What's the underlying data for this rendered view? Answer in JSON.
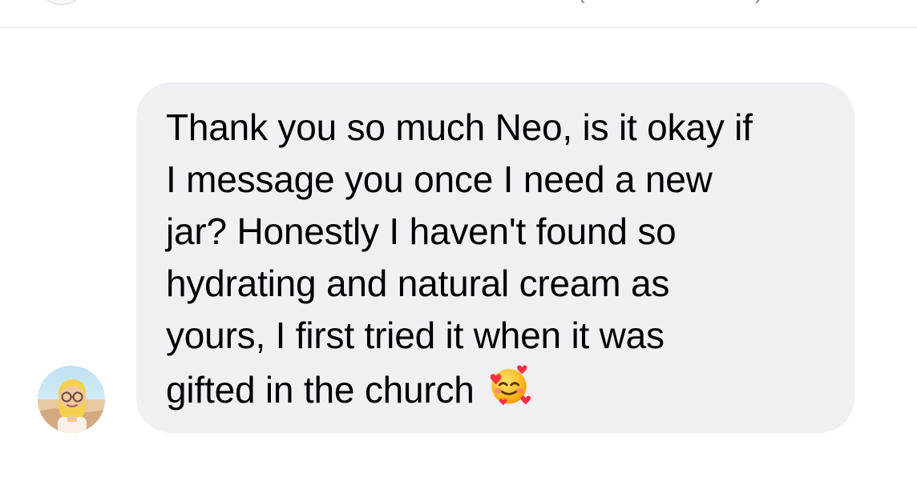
{
  "header": {
    "avatar_icon": "contact-avatar-icon",
    "left_paren": "(",
    "right_paren": ")"
  },
  "message": {
    "lines": [
      "Thank you so much Neo, is it okay if",
      "I message you once I need a new",
      "jar? Honestly I haven't found so",
      "hydrating and natural cream as",
      "yours, I first tried it when it was",
      "gifted in the church"
    ],
    "emoji_icon": "smiling-face-with-hearts-icon",
    "bubble_color": "#efeff4",
    "text_color": "#000000"
  },
  "sender": {
    "avatar_icon": "sender-avatar-icon"
  }
}
